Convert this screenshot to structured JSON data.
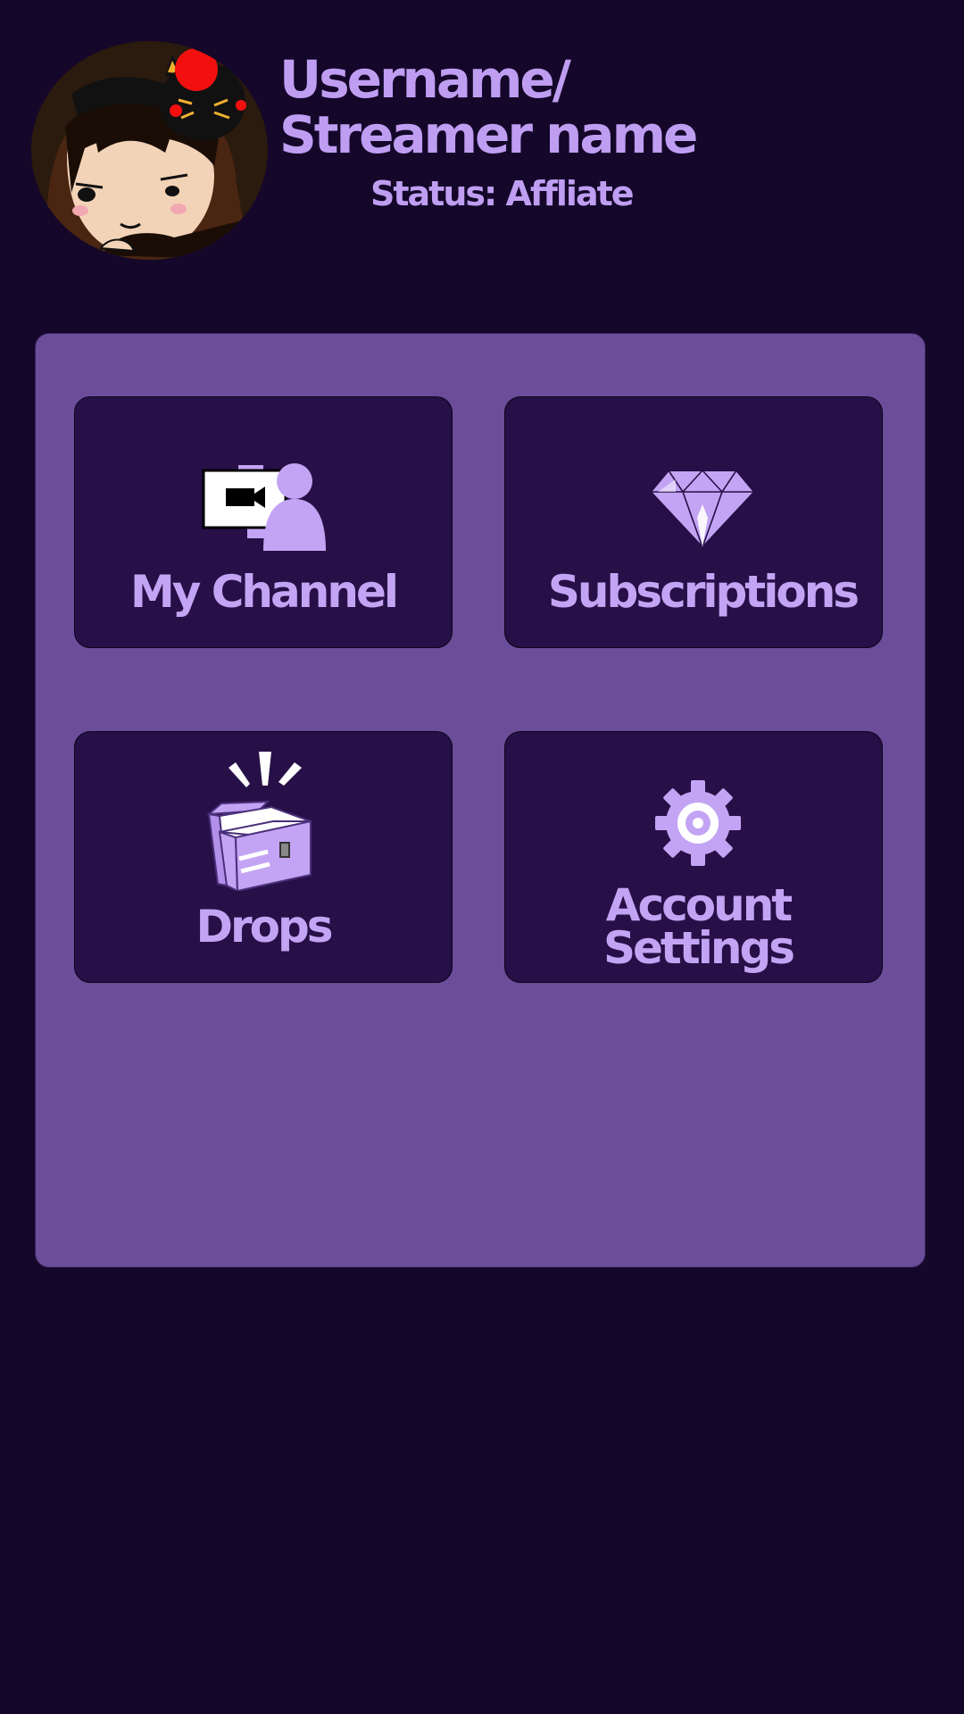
{
  "profile": {
    "name_line1": "Username/",
    "name_line2": "Streamer name",
    "status": "Status: Affliate",
    "avatar_icon": "streamer-avatar"
  },
  "menu": {
    "items": [
      {
        "id": "my-channel",
        "label": "My Channel",
        "icon": "channel-camera-person-icon"
      },
      {
        "id": "subscriptions",
        "label": "Subscriptions",
        "icon": "diamond-icon"
      },
      {
        "id": "drops",
        "label": "Drops",
        "icon": "open-box-icon"
      },
      {
        "id": "account-settings",
        "label_line1": "Account",
        "label_line2": "Settings",
        "icon": "gear-icon"
      }
    ]
  },
  "colors": {
    "background": "#14072a",
    "panel": "#6b4d9a",
    "tile": "#261047",
    "accent": "#bf9ef2"
  }
}
